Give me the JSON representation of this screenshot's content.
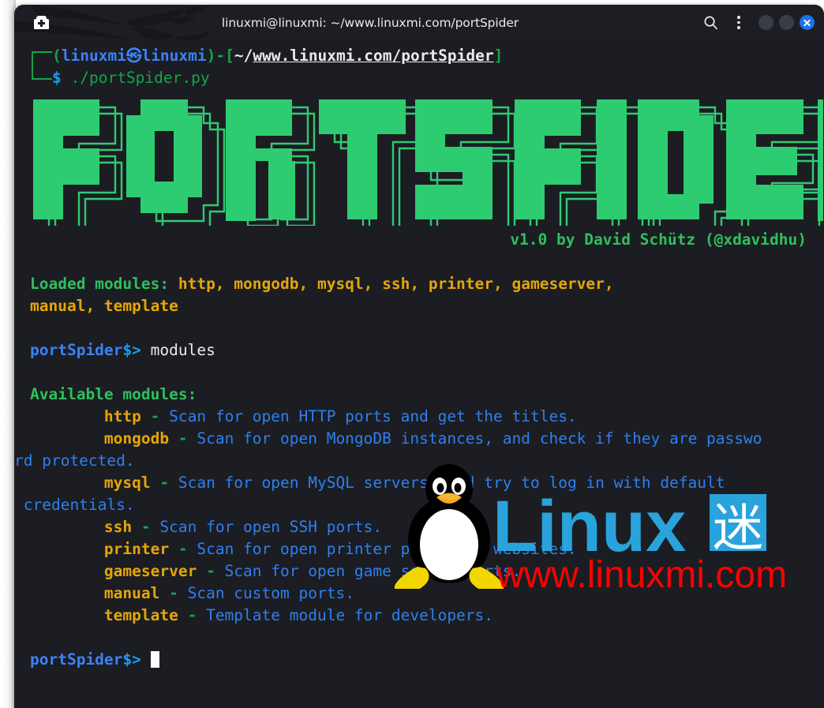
{
  "window": {
    "title": "linuxmi@linuxmi: ~/www.linuxmi.com/portSpider",
    "new_tab_icon": "new-tab-icon",
    "search_icon": "search-icon",
    "menu_icon": "kebab-menu-icon",
    "minimize_label": "",
    "maximize_label": "",
    "close_icon": "close-icon",
    "accent_close": "#1a73e8",
    "background": "#1b1d22"
  },
  "prompt": {
    "paren_open": "(",
    "user": "linuxmi",
    "at_symbol": "㉿",
    "host": "linuxmi",
    "paren_close": ")",
    "dash": "-",
    "bracket_open": "[",
    "tilde": "~/",
    "path": "www.linuxmi.com/portSpider",
    "bracket_close": "]",
    "dollar": "$",
    "command": " ./portSpider.py"
  },
  "banner": {
    "text": "PORTSPIDER",
    "color": "#2ecc71",
    "outline_color": "#2ecc71"
  },
  "version_line": {
    "text": "v1.0 by David Schütz (@xdavidhu)",
    "color": "#2fbf5c"
  },
  "loaded": {
    "label": "Loaded modules:",
    "line1_modules": " http, mongodb, mysql, ssh, printer, gameserver,",
    "line2_modules": "manual, template"
  },
  "shell": {
    "name": "portSpider",
    "symbol": "$>",
    "entered_command": " modules",
    "empty_command": " "
  },
  "available": {
    "header": "Available modules:",
    "modules": [
      {
        "name": "http",
        "sep": " - ",
        "desc": "Scan for open HTTP ports and get the titles."
      },
      {
        "name": "mongodb",
        "sep": " - ",
        "desc": "Scan for open MongoDB instances, and check if they are passwo"
      },
      {
        "name": "",
        "sep": "",
        "desc": "rd protected."
      },
      {
        "name": "mysql",
        "sep": " - ",
        "desc": "Scan for open MySQL servers, and try to log in with default"
      },
      {
        "name": "",
        "sep": "",
        "desc": " credentials."
      },
      {
        "name": "ssh",
        "sep": " - ",
        "desc": "Scan for open SSH ports."
      },
      {
        "name": "printer",
        "sep": " - ",
        "desc": "Scan for open printer ports and websites."
      },
      {
        "name": "gameserver",
        "sep": " - ",
        "desc": "Scan for open game server ports."
      },
      {
        "name": "manual",
        "sep": " - ",
        "desc": "Scan custom ports."
      },
      {
        "name": "template",
        "sep": " - ",
        "desc": "Template module for developers."
      }
    ],
    "name_color": "#e5a50a",
    "desc_color": "#2f7ff0"
  },
  "watermark": {
    "brand": "Linux",
    "cjk": "迷",
    "url": "www.linuxmi.com",
    "brand_color": "#29a3dc",
    "url_color": "#ff0000",
    "mascot": "tux-penguin-icon"
  }
}
